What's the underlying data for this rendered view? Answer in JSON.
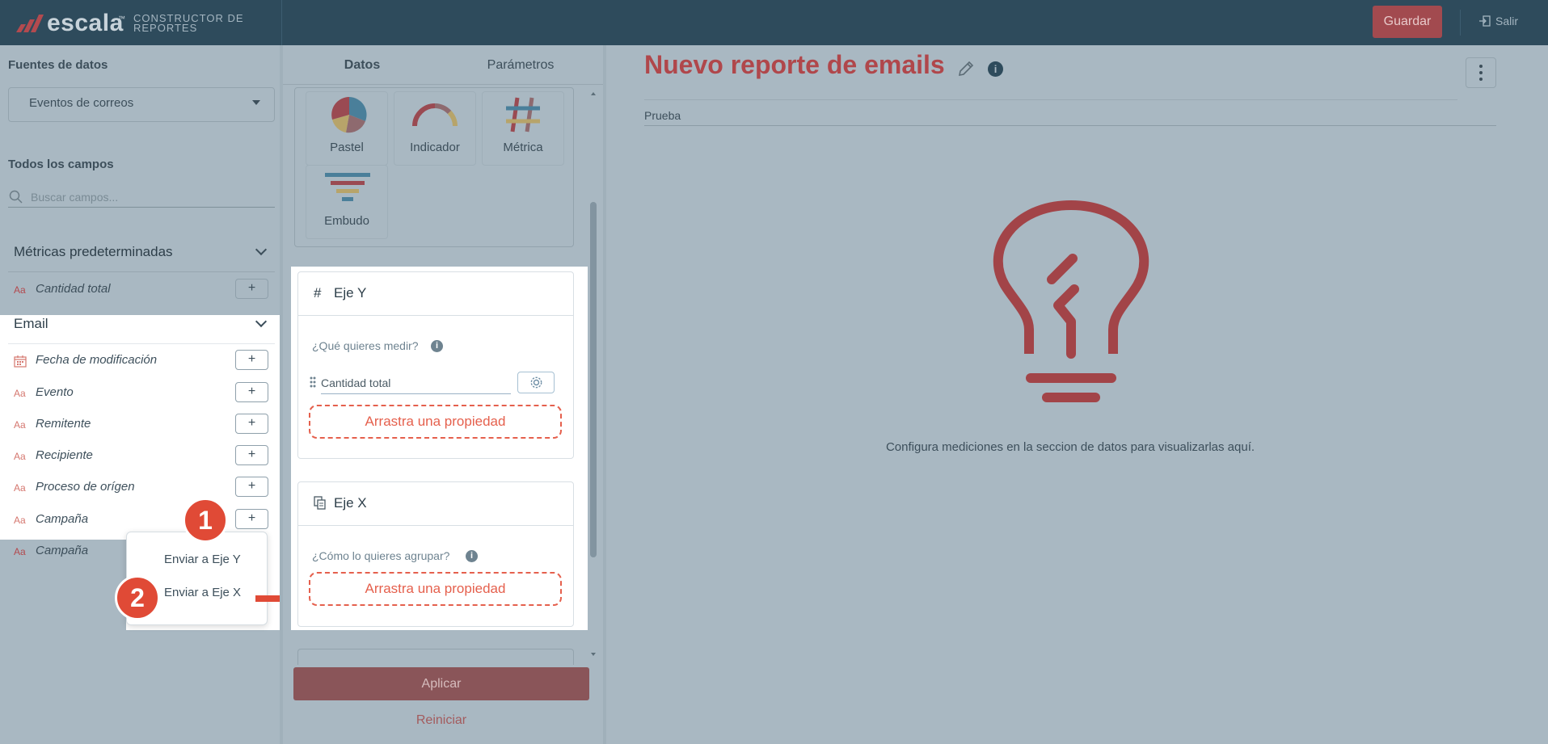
{
  "header": {
    "brand": "escala",
    "brand_tm": "™",
    "brand_sub_1": "CONSTRUCTOR DE",
    "brand_sub_2": "REPORTES",
    "save_label": "Guardar",
    "exit_label": "Salir"
  },
  "left": {
    "sources_title": "Fuentes de datos",
    "source_selected": "Eventos de correos",
    "all_fields_title": "Todos los campos",
    "search_placeholder": "Buscar campos...",
    "groups": {
      "default_metrics": {
        "title": "Métricas predeterminadas",
        "items": [
          {
            "type": "Aa",
            "label": "Cantidad total"
          }
        ]
      },
      "email": {
        "title": "Email",
        "items": [
          {
            "type": "calendar",
            "label": "Fecha de modificación"
          },
          {
            "type": "Aa",
            "label": "Evento"
          },
          {
            "type": "Aa",
            "label": "Remitente"
          },
          {
            "type": "Aa",
            "label": "Recipiente"
          },
          {
            "type": "Aa",
            "label": "Proceso de orígen"
          },
          {
            "type": "Aa",
            "label": "Campaña"
          },
          {
            "type": "Aa",
            "label": "Campaña"
          }
        ]
      }
    },
    "plus": "+",
    "popup": {
      "send_y": "Enviar a Eje Y",
      "send_x": "Enviar a Eje X"
    }
  },
  "callouts": {
    "one": "1",
    "two": "2"
  },
  "middle": {
    "tabs": {
      "data": "Datos",
      "params": "Parámetros"
    },
    "charts": {
      "pie": "Pastel",
      "gauge": "Indicador",
      "metric": "Métrica",
      "funnel": "Embudo"
    },
    "axis_y": {
      "title": "Eje Y",
      "question": "¿Qué quieres medir?",
      "measure": "Cantidad total",
      "drop": "Arrastra una propiedad"
    },
    "axis_x": {
      "title": "Eje X",
      "question": "¿Cómo lo quieres agrupar?",
      "drop": "Arrastra una propiedad"
    },
    "apply_label": "Aplicar",
    "reset_label": "Reiniciar"
  },
  "canvas": {
    "title": "Nuevo reporte de emails",
    "subtitle": "Prueba",
    "empty_message": "Configura mediciones en la seccion de datos para visualizarlas aquí."
  },
  "colors": {
    "accent": "#e04a36",
    "brand_red": "#b0474b",
    "topbar": "#2e4b5c"
  }
}
